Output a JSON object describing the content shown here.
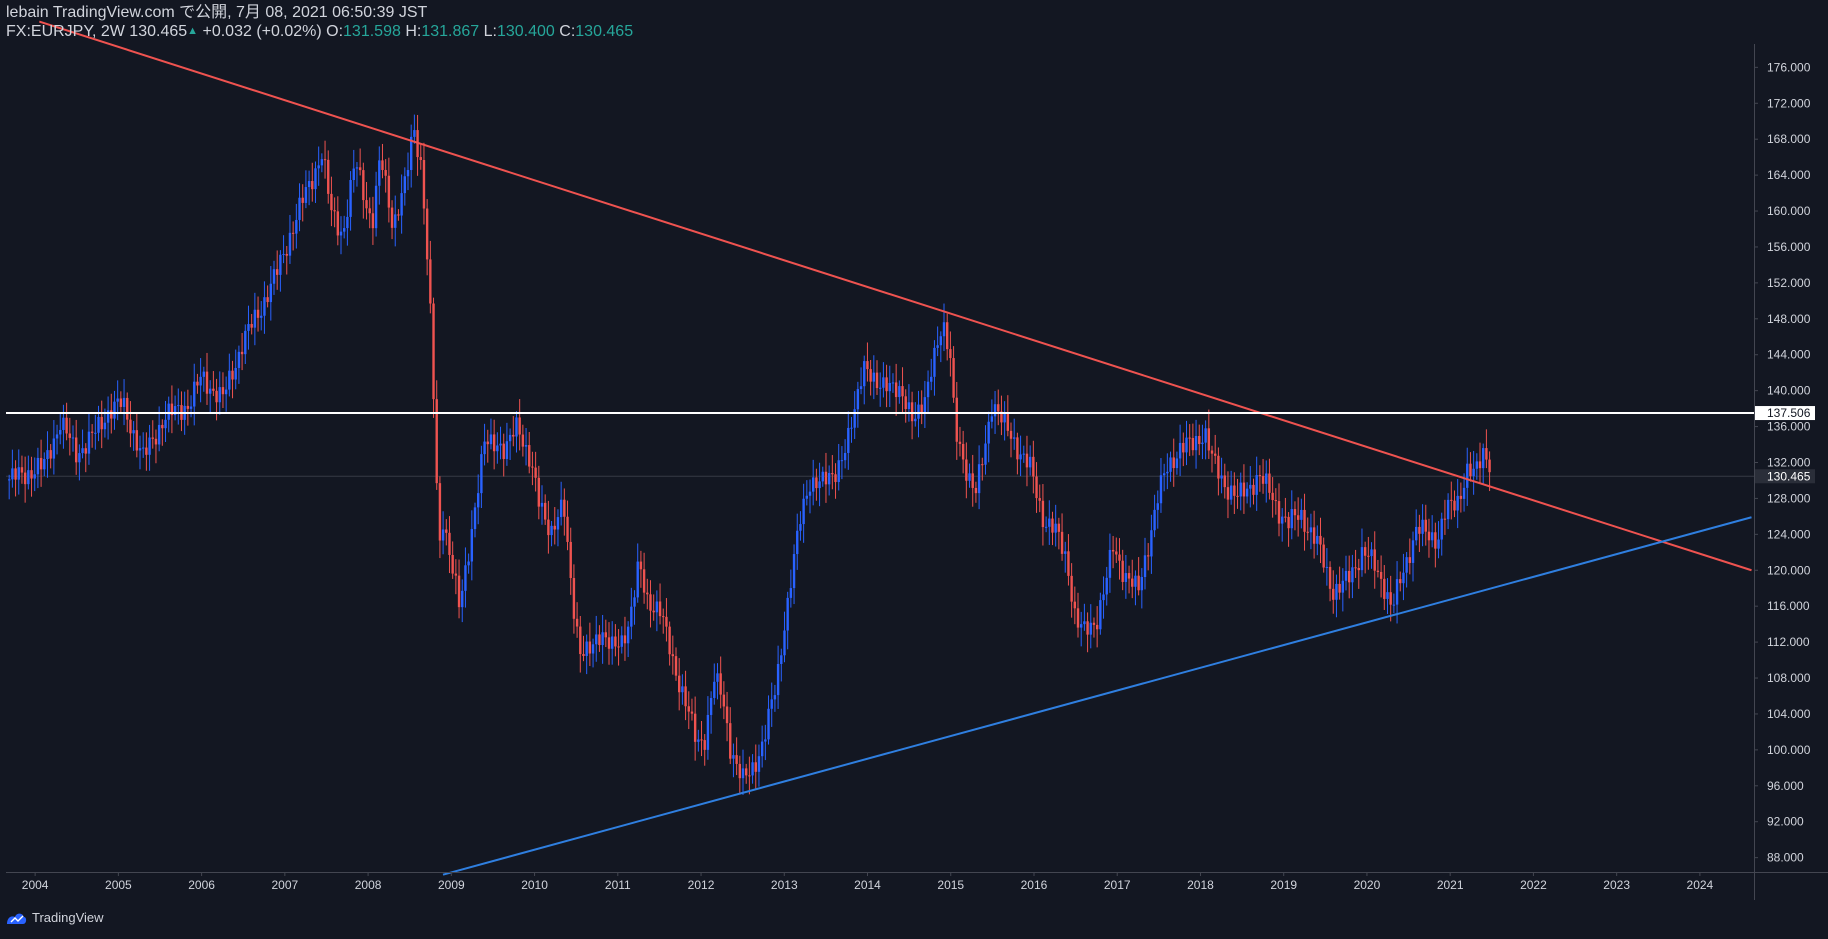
{
  "header": {
    "publish_line": "lebain TradingView.com で公開, 7月 08, 2021 06:50:39 JST",
    "symbol": "FX:EURJPY, 2W",
    "last_price": "130.465",
    "change": "+0.032 (+0.02%)",
    "open_label": "O:",
    "open_value": "131.598",
    "high_label": "H:",
    "high_value": "131.867",
    "low_label": "L:",
    "low_value": "130.400",
    "close_label": "C:",
    "close_value": "130.465"
  },
  "footer": {
    "brand": "TradingView",
    "logo_icon": "tradingview-logo-icon"
  },
  "colors": {
    "background": "#131722",
    "up": "#2962ff",
    "down": "#ef5350",
    "resistance_line": "#ef5350",
    "support_line": "#2f7fe0",
    "horizontal_level": "#ffffff",
    "text": "#d1d4dc",
    "axis_border": "#434651"
  },
  "chart_data": {
    "type": "candlestick",
    "interval": "2W",
    "symbol": "FX:EURJPY",
    "x_tick_labels": [
      "2004",
      "2005",
      "2006",
      "2007",
      "2008",
      "2009",
      "2010",
      "2011",
      "2012",
      "2013",
      "2014",
      "2015",
      "2016",
      "2017",
      "2018",
      "2019",
      "2020",
      "2021",
      "2022",
      "2023",
      "2024"
    ],
    "y_tick_labels": [
      "88.000",
      "92.000",
      "96.000",
      "100.000",
      "104.000",
      "108.000",
      "112.000",
      "116.000",
      "120.000",
      "124.000",
      "128.000",
      "132.000",
      "136.000",
      "140.000",
      "144.000",
      "148.000",
      "152.000",
      "156.000",
      "160.000",
      "164.000",
      "168.000",
      "172.000",
      "176.000"
    ],
    "xlim": [
      2003.65,
      2024.65
    ],
    "ylim": [
      86.4,
      178.6
    ],
    "price_path": [
      [
        2003.65,
        130.0
      ],
      [
        2004.1,
        131.5
      ],
      [
        2004.3,
        136.5
      ],
      [
        2004.5,
        133.0
      ],
      [
        2004.7,
        135.0
      ],
      [
        2004.9,
        138.0
      ],
      [
        2005.05,
        138.5
      ],
      [
        2005.3,
        132.5
      ],
      [
        2005.55,
        137.0
      ],
      [
        2005.85,
        138.5
      ],
      [
        2006.0,
        141.5
      ],
      [
        2006.25,
        139.0
      ],
      [
        2006.5,
        145.5
      ],
      [
        2006.7,
        149.0
      ],
      [
        2006.9,
        153.0
      ],
      [
        2007.05,
        157.0
      ],
      [
        2007.25,
        162.0
      ],
      [
        2007.45,
        166.5
      ],
      [
        2007.55,
        160.0
      ],
      [
        2007.7,
        157.5
      ],
      [
        2007.85,
        165.5
      ],
      [
        2007.95,
        162.0
      ],
      [
        2008.05,
        158.5
      ],
      [
        2008.15,
        166.0
      ],
      [
        2008.3,
        158.5
      ],
      [
        2008.45,
        163.0
      ],
      [
        2008.55,
        169.5
      ],
      [
        2008.65,
        164.5
      ],
      [
        2008.75,
        148.0
      ],
      [
        2008.8,
        136.0
      ],
      [
        2008.85,
        122.0
      ],
      [
        2008.9,
        126.0
      ],
      [
        2009.0,
        121.0
      ],
      [
        2009.1,
        115.5
      ],
      [
        2009.25,
        125.0
      ],
      [
        2009.4,
        134.0
      ],
      [
        2009.55,
        134.5
      ],
      [
        2009.65,
        133.0
      ],
      [
        2009.8,
        136.5
      ],
      [
        2009.95,
        132.0
      ],
      [
        2010.05,
        127.5
      ],
      [
        2010.2,
        124.5
      ],
      [
        2010.35,
        127.0
      ],
      [
        2010.45,
        117.5
      ],
      [
        2010.55,
        111.0
      ],
      [
        2010.65,
        110.5
      ],
      [
        2010.8,
        113.5
      ],
      [
        2010.95,
        111.0
      ],
      [
        2011.05,
        112.0
      ],
      [
        2011.15,
        115.0
      ],
      [
        2011.25,
        120.5
      ],
      [
        2011.35,
        116.5
      ],
      [
        2011.5,
        116.0
      ],
      [
        2011.65,
        110.0
      ],
      [
        2011.8,
        106.0
      ],
      [
        2011.95,
        100.5
      ],
      [
        2012.05,
        101.5
      ],
      [
        2012.15,
        108.0
      ],
      [
        2012.25,
        106.0
      ],
      [
        2012.35,
        100.5
      ],
      [
        2012.5,
        96.5
      ],
      [
        2012.6,
        97.5
      ],
      [
        2012.75,
        101.0
      ],
      [
        2012.9,
        107.0
      ],
      [
        2013.0,
        114.0
      ],
      [
        2013.1,
        120.0
      ],
      [
        2013.2,
        126.0
      ],
      [
        2013.3,
        130.0
      ],
      [
        2013.45,
        129.5
      ],
      [
        2013.6,
        131.0
      ],
      [
        2013.75,
        133.5
      ],
      [
        2013.85,
        138.0
      ],
      [
        2013.95,
        143.5
      ],
      [
        2014.1,
        140.0
      ],
      [
        2014.25,
        141.5
      ],
      [
        2014.4,
        139.0
      ],
      [
        2014.55,
        137.5
      ],
      [
        2014.7,
        138.5
      ],
      [
        2014.8,
        144.0
      ],
      [
        2014.9,
        148.0
      ],
      [
        2015.0,
        143.0
      ],
      [
        2015.05,
        135.5
      ],
      [
        2015.2,
        131.0
      ],
      [
        2015.3,
        128.5
      ],
      [
        2015.4,
        133.0
      ],
      [
        2015.5,
        139.0
      ],
      [
        2015.65,
        136.0
      ],
      [
        2015.85,
        133.0
      ],
      [
        2015.95,
        131.5
      ],
      [
        2016.1,
        126.0
      ],
      [
        2016.25,
        124.5
      ],
      [
        2016.4,
        121.0
      ],
      [
        2016.5,
        114.5
      ],
      [
        2016.6,
        113.0
      ],
      [
        2016.75,
        114.5
      ],
      [
        2016.85,
        118.0
      ],
      [
        2016.95,
        122.5
      ],
      [
        2017.1,
        119.5
      ],
      [
        2017.25,
        117.5
      ],
      [
        2017.35,
        122.0
      ],
      [
        2017.5,
        128.5
      ],
      [
        2017.6,
        131.5
      ],
      [
        2017.75,
        133.5
      ],
      [
        2017.9,
        134.0
      ],
      [
        2018.05,
        135.5
      ],
      [
        2018.15,
        132.0
      ],
      [
        2018.3,
        129.5
      ],
      [
        2018.45,
        128.0
      ],
      [
        2018.55,
        129.0
      ],
      [
        2018.7,
        130.5
      ],
      [
        2018.85,
        128.5
      ],
      [
        2018.95,
        126.5
      ],
      [
        2019.05,
        125.0
      ],
      [
        2019.2,
        126.5
      ],
      [
        2019.3,
        124.5
      ],
      [
        2019.45,
        122.0
      ],
      [
        2019.6,
        117.5
      ],
      [
        2019.7,
        118.0
      ],
      [
        2019.85,
        120.5
      ],
      [
        2019.95,
        122.0
      ],
      [
        2020.1,
        120.5
      ],
      [
        2020.2,
        118.5
      ],
      [
        2020.3,
        115.5
      ],
      [
        2020.45,
        120.5
      ],
      [
        2020.6,
        124.5
      ],
      [
        2020.75,
        124.0
      ],
      [
        2020.85,
        123.5
      ],
      [
        2020.95,
        126.5
      ],
      [
        2021.1,
        128.0
      ],
      [
        2021.2,
        131.0
      ],
      [
        2021.3,
        130.5
      ],
      [
        2021.4,
        133.5
      ],
      [
        2021.5,
        131.598
      ]
    ],
    "annotations": {
      "resistance_trendline": {
        "points": [
          [
            2004.05,
            181.1
          ],
          [
            2024.62,
            120.0
          ]
        ]
      },
      "support_trendline": {
        "points": [
          [
            2008.9,
            86.1
          ],
          [
            2024.62,
            125.9
          ]
        ]
      },
      "horizontal_level": {
        "price": 137.506,
        "label": "137.506"
      },
      "last_price": {
        "price": 130.465,
        "label": "130.465"
      }
    }
  }
}
